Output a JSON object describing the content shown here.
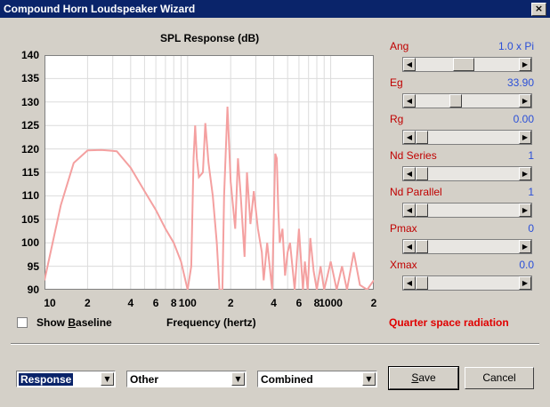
{
  "window": {
    "title": "Compound Horn Loudspeaker Wizard",
    "close": "×"
  },
  "chart_data": {
    "type": "line",
    "title": "SPL Response (dB)",
    "xlabel": "Frequency (hertz)",
    "ylabel": "",
    "xscale": "log",
    "xlim": [
      10,
      2000
    ],
    "ylim": [
      90,
      140
    ],
    "yticks": [
      "140",
      "135",
      "130",
      "125",
      "120",
      "115",
      "110",
      "105",
      "100",
      "95",
      "90"
    ],
    "xticks": [
      "10",
      "2",
      "4",
      "6",
      "8",
      "100",
      "2",
      "4",
      "6",
      "8",
      "1000",
      "2"
    ],
    "grid": true,
    "series": [
      {
        "color": "#f4a0a0",
        "x": [
          10,
          13,
          16,
          20,
          25,
          32,
          40,
          50,
          60,
          70,
          80,
          90,
          100,
          106,
          110,
          113,
          116,
          120,
          128,
          133,
          140,
          150,
          160,
          167,
          175,
          180,
          190,
          200,
          215,
          225,
          235,
          250,
          260,
          275,
          290,
          310,
          330,
          340,
          360,
          390,
          410,
          420,
          430,
          440,
          460,
          480,
          500,
          520,
          560,
          600,
          640,
          660,
          690,
          720,
          760,
          800,
          850,
          900,
          950,
          1000,
          1100,
          1200,
          1300,
          1450,
          1600,
          1800,
          2000
        ],
        "values": [
          92,
          108,
          117,
          119.7,
          119.8,
          119.5,
          116,
          111,
          107,
          103,
          100,
          96,
          90,
          95,
          118,
          125,
          118,
          114,
          115,
          125.5,
          117,
          110,
          100,
          90,
          90,
          110,
          129,
          113,
          103,
          118,
          110,
          97,
          115,
          104,
          111,
          103,
          98,
          92,
          100,
          90,
          119,
          118,
          107,
          100,
          103,
          93,
          98,
          100,
          90,
          103,
          90,
          96,
          90,
          101,
          94,
          90,
          95,
          90,
          93,
          96,
          90,
          95,
          90,
          98,
          91,
          90,
          92
        ]
      }
    ]
  },
  "sliders": [
    {
      "label": "Ang",
      "value": "1.0 x Pi",
      "level": 0.46
    },
    {
      "label": "Eg",
      "value": "33.90",
      "level": 0.37
    },
    {
      "label": "Rg",
      "value": "0.00",
      "level": 0.0
    },
    {
      "label": "Nd  Series",
      "value": "1",
      "level": 0.0
    },
    {
      "label": "Nd  Parallel",
      "value": "1",
      "level": 0.0
    },
    {
      "label": "Pmax",
      "value": "0",
      "level": 0.0
    },
    {
      "label": "Xmax",
      "value": "0.0",
      "level": 0.0
    }
  ],
  "show_baseline": {
    "label": "Show Baseline",
    "checked": false
  },
  "radiation_text": "Quarter space radiation",
  "combos": [
    {
      "value": "Response"
    },
    {
      "value": "Other"
    },
    {
      "value": "Combined"
    }
  ],
  "buttons": {
    "save": "Save",
    "cancel": "Cancel"
  },
  "icons": {
    "arrow_left": "◀",
    "arrow_right": "▶",
    "arrow_down": "▼"
  }
}
